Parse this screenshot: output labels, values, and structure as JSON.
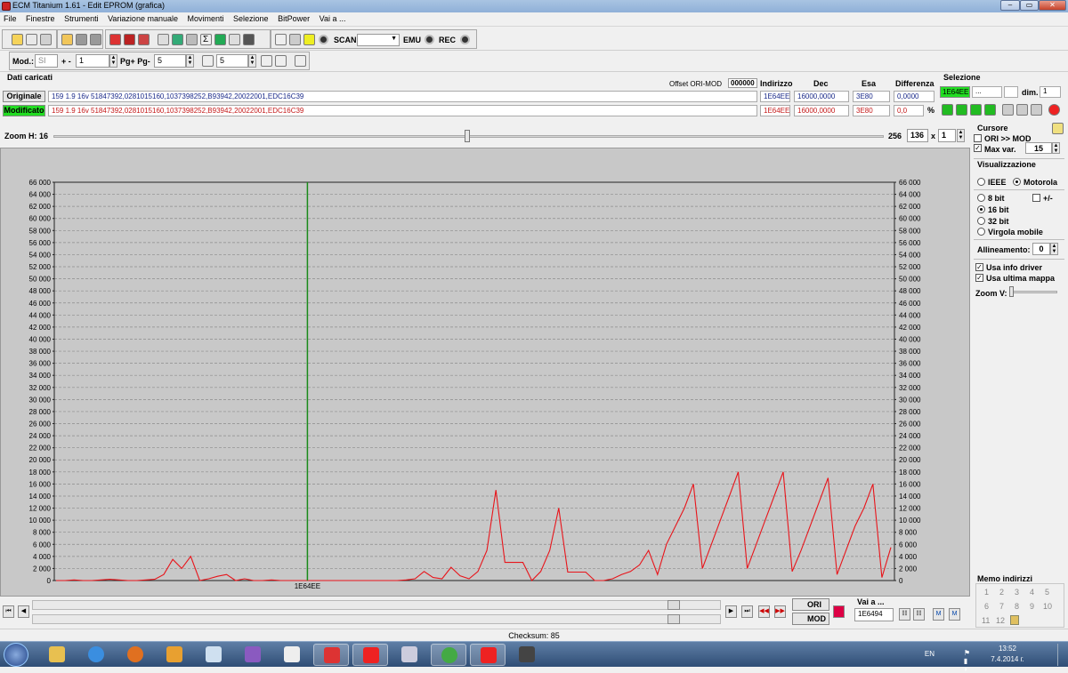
{
  "window": {
    "title": "ECM Titanium 1.61 - Edit EPROM (grafica)"
  },
  "menu": [
    "File",
    "Finestre",
    "Strumenti",
    "Variazione manuale",
    "Movimenti",
    "Selezione",
    "BitPower",
    "Vai a ..."
  ],
  "toolbar": {
    "scan_label": "SCAN",
    "emu_label": "EMU",
    "rec_label": "REC"
  },
  "toolbar2": {
    "mod_label": "Mod.:",
    "mod_value": "SI",
    "plusminus_label": "+ -",
    "step_value": "1",
    "pg_label": "Pg+ Pg-",
    "pg_value": "5",
    "p_value": "5"
  },
  "data_section": {
    "title": "Dati caricati",
    "offset_label": "Offset ORI-MOD",
    "offset_value": "000000",
    "col_indirizzo": "Indirizzo",
    "col_dec": "Dec",
    "col_esa": "Esa",
    "col_differenza": "Differenza",
    "originale": {
      "label": "Originale",
      "desc": "159 1.9 16v 51847392,0281015160,1037398252,B93942,20022001,EDC16C39",
      "indirizzo": "1E64EE",
      "dec": "16000,0000",
      "esa": "3E80",
      "diff": "0,0000"
    },
    "modificato": {
      "label": "Modificato",
      "desc": "159 1.9 16v 51847392,0281015160,1037398252,B93942,20022001,EDC16C39",
      "indirizzo": "1E64EE",
      "dec": "16000,0000",
      "esa": "3E80",
      "diff": "0,0",
      "diff_unit": "%"
    }
  },
  "selezione": {
    "title": "Selezione",
    "start": "1E64EE",
    "end": "...",
    "dim_label": "dim.",
    "dim_value": "1"
  },
  "zoom_h": {
    "label": "Zoom H: 16",
    "value_a": "256",
    "value_b": "136",
    "times": "x",
    "value_c": "1"
  },
  "right_panel": {
    "cursore_title": "Cursore",
    "ori_mod": "ORI >> MOD",
    "max_var_label": "Max var.",
    "max_var_value": "15",
    "visualizzazione_title": "Visualizzazione",
    "ieee": "IEEE",
    "motorola": "Motorola",
    "bit8": "8 bit",
    "plusminus": "+/-",
    "bit16": "16 bit",
    "bit32": "32 bit",
    "virgola": "Virgola mobile",
    "allineamento_label": "Allineamento:",
    "allineamento_value": "0",
    "usa_info_driver": "Usa info driver",
    "usa_ultima_mappa": "Usa ultima mappa",
    "zoom_v": "Zoom V:",
    "memo_title": "Memo indirizzi",
    "memo": [
      "1",
      "2",
      "3",
      "4",
      "5",
      "6",
      "7",
      "8",
      "9",
      "10",
      "11",
      "12"
    ]
  },
  "bottom": {
    "ori_btn": "ORI",
    "mod_btn": "MOD",
    "vai_label": "Vai a ...",
    "vai_value": "1E6494",
    "checksum": "Checksum: 85"
  },
  "taskbar": {
    "lang": "EN",
    "time": "13:52",
    "date": "7.4.2014 г."
  },
  "colors": {
    "series": "#e8141a",
    "cursor": "#1a8a1a",
    "chart_bg": "#c8c8c8",
    "selected_green": "#22dd22"
  },
  "chart_data": {
    "type": "line",
    "cursor_label": "1E64EE",
    "ylim": [
      0,
      66000
    ],
    "y_ticks": [
      "0",
      "2 000",
      "4 000",
      "6 000",
      "8 000",
      "10 000",
      "12 000",
      "14 000",
      "16 000",
      "18 000",
      "20 000",
      "22 000",
      "24 000",
      "26 000",
      "28 000",
      "30 000",
      "32 000",
      "34 000",
      "36 000",
      "38 000",
      "40 000",
      "42 000",
      "44 000",
      "46 000",
      "48 000",
      "50 000",
      "52 000",
      "54 000",
      "56 000",
      "58 000",
      "60 000",
      "62 000",
      "64 000",
      "66 000"
    ],
    "cursor_index": 28,
    "series": [
      {
        "values": [
          0,
          0,
          100,
          0,
          0,
          100,
          200,
          100,
          0,
          0,
          100,
          200,
          1000,
          3500,
          2000,
          4000,
          0,
          300,
          700,
          1000,
          0,
          300,
          0,
          0,
          100,
          0,
          0,
          0,
          0,
          0,
          0,
          0,
          0,
          0,
          0,
          0,
          0,
          0,
          0,
          100,
          300,
          1500,
          500,
          300,
          2200,
          800,
          300,
          1500,
          5000,
          15000,
          3000,
          3000,
          3000,
          0,
          1500,
          5000,
          12000,
          1400,
          1400,
          1400,
          0,
          0,
          300,
          1000,
          1500,
          2600,
          5000,
          1000,
          6000,
          9000,
          12000,
          16000,
          2000,
          6000,
          10000,
          14000,
          18000,
          2000,
          6000,
          10000,
          14000,
          18000,
          1500,
          5000,
          9000,
          13000,
          17000,
          1000,
          5000,
          9000,
          12000,
          16000,
          500,
          5500
        ]
      }
    ]
  }
}
